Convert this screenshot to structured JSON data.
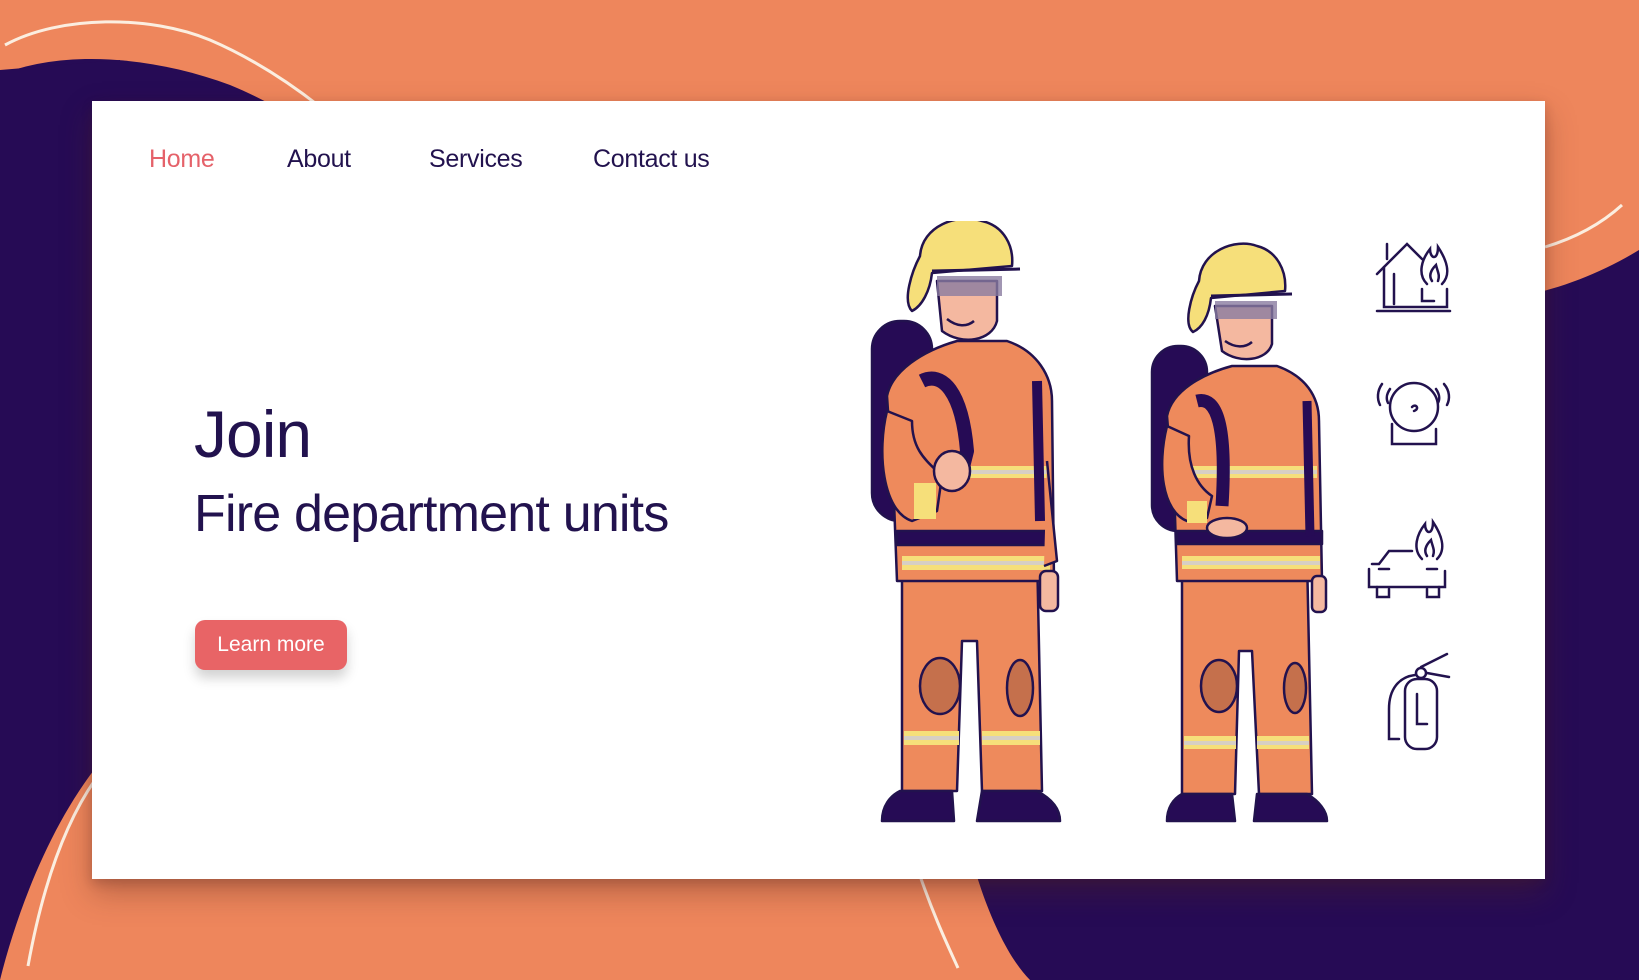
{
  "nav": {
    "items": [
      {
        "label": "Home",
        "active": true
      },
      {
        "label": "About",
        "active": false
      },
      {
        "label": "Services",
        "active": false
      },
      {
        "label": "Contact us",
        "active": false
      }
    ]
  },
  "hero": {
    "title_line1": "Join",
    "title_line2": "Fire department units",
    "cta_label": "Learn more"
  },
  "illustration": {
    "subject": "two firefighters in protective gear",
    "figures": [
      "firefighter-man",
      "firefighter-woman"
    ]
  },
  "side_icons": [
    "burning-house-icon",
    "fire-alarm-bell-icon",
    "burning-car-icon",
    "fire-extinguisher-icon"
  ],
  "colors": {
    "background_orange": "#ee865c",
    "background_purple": "#260b55",
    "text_dark": "#22124e",
    "accent_red": "#e86466",
    "card_white": "#ffffff",
    "helmet_yellow": "#f6df7a",
    "suit_orange": "#ee8a5c"
  }
}
